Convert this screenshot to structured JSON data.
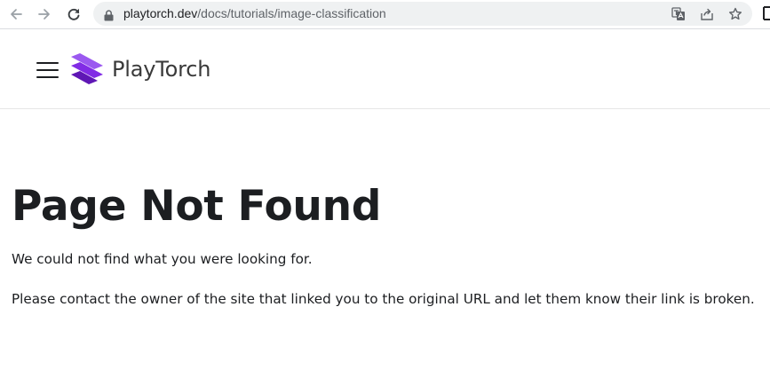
{
  "browser": {
    "url_host": "playtorch.dev",
    "url_path": "/docs/tutorials/image-classification",
    "icons": [
      "back-arrow-icon",
      "forward-arrow-icon",
      "reload-icon",
      "lock-icon",
      "translate-icon",
      "share-icon",
      "star-icon"
    ]
  },
  "navbar": {
    "brand_name": "PlayTorch",
    "icons": [
      "hamburger-menu-icon",
      "playtorch-logo"
    ]
  },
  "content": {
    "title": "Page Not Found",
    "paragraph_1": "We could not find what you were looking for.",
    "paragraph_2": "Please contact the owner of the site that linked you to the original URL and let them know their link is broken."
  },
  "colors": {
    "text": "#1c1e21",
    "brand_purple": "#812CE5",
    "omnibox_bg": "#eff1f2"
  }
}
